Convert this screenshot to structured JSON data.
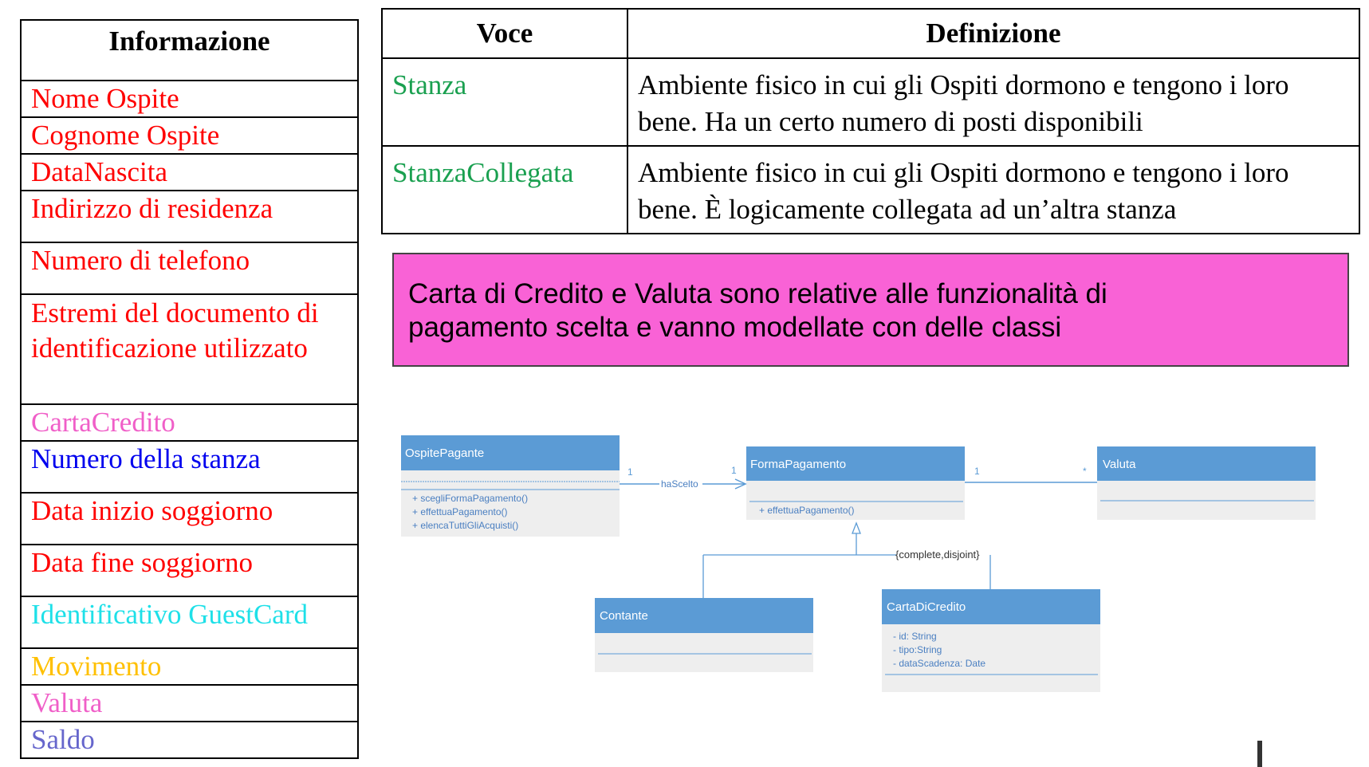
{
  "info_table": {
    "header": "Informazione",
    "rows": [
      {
        "text": "Nome Ospite",
        "color": "#ff0000"
      },
      {
        "text": "Cognome Ospite",
        "color": "#ff0000"
      },
      {
        "text": "DataNascita",
        "color": "#ff0000"
      },
      {
        "text": "Indirizzo di residenza",
        "color": "#ff0000"
      },
      {
        "text": "Numero di telefono",
        "color": "#ff0000"
      },
      {
        "text": "Estremi del documento di identificazione utilizzato",
        "color": "#ff0000"
      },
      {
        "text": "CartaCredito",
        "color": "#f05fc8"
      },
      {
        "text": "Numero della stanza",
        "color": "#0000ee"
      },
      {
        "text": "Data inizio soggiorno",
        "color": "#ff0000"
      },
      {
        "text": "Data fine soggiorno",
        "color": "#ff0000"
      },
      {
        "text": "Identificativo GuestCard",
        "color": "#1ee0e8"
      },
      {
        "text": "Movimento",
        "color": "#ffc000"
      },
      {
        "text": "Valuta",
        "color": "#f05fc8"
      },
      {
        "text": "Saldo",
        "color": "#6666cc"
      }
    ]
  },
  "voce_table": {
    "header_voce": "Voce",
    "header_definizione": "Definizione",
    "rows": [
      {
        "voce": "Stanza",
        "definizione": "Ambiente fisico in cui gli Ospiti dormono e tengono i loro bene. Ha un certo numero di posti disponibili"
      },
      {
        "voce": "StanzaCollegata",
        "definizione": "Ambiente fisico in cui gli Ospiti dormono e tengono i loro bene. È logicamente collegata ad un’altra stanza"
      }
    ]
  },
  "note": {
    "line1": "Carta di Credito e Valuta sono relative alle funzionalità di",
    "line2": "pagamento scelta e vanno modellate con delle classi"
  },
  "uml": {
    "classes": {
      "ospite_pagante": {
        "name": "OspitePagante",
        "methods": [
          "+ scegliFormaPagamento()",
          "+ effettuaPagamento()",
          "+ elencaTuttiGliAcquisti()"
        ]
      },
      "forma_pagamento": {
        "name": "FormaPagamento",
        "methods": [
          "+ effettuaPagamento()"
        ]
      },
      "valuta": {
        "name": "Valuta"
      },
      "contante": {
        "name": "Contante"
      },
      "carta_di_credito": {
        "name": "CartaDiCredito",
        "attributes": [
          "- id: String",
          "- tipo:String",
          "- dataScadenza: Date"
        ]
      }
    },
    "associations": {
      "ha_scelto": {
        "label": "haScelto",
        "mult_source": "1",
        "mult_target": "1"
      },
      "valuta_assoc": {
        "mult_source": "1",
        "mult_target": "*"
      }
    },
    "generalization_constraint": "{complete,disjoint}",
    "colors": {
      "header_fill": "#5b9bd5",
      "body_fill": "#eeeeee",
      "line": "#5b9bd5",
      "text_body": "#4a7fc1",
      "generalization_line": "#4a4a4a"
    }
  }
}
